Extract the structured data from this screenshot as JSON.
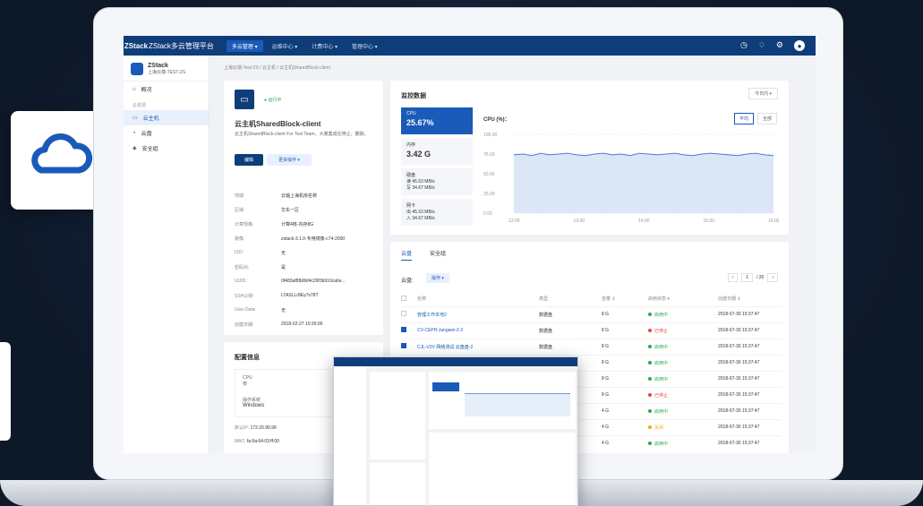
{
  "header": {
    "logo": "ZStack",
    "app_title": "ZStack多云管理平台",
    "nav": [
      "多云管理 ▾",
      "运维中心 ▾",
      "计费中心 ▾",
      "管理中心 ▾"
    ],
    "icons": [
      "history-icon",
      "bell-icon",
      "gear-icon",
      "user-icon"
    ]
  },
  "sidebar": {
    "zone_name": "ZStack",
    "zone_sub": "上海云端-TEST-ZS",
    "overview": "概况",
    "section": "云资源",
    "items": [
      "云主机",
      "云盘",
      "安全组"
    ]
  },
  "breadcrumb": "上海云端-Test-ZS / 云主机 / 云主机SharedBlock-client",
  "vm": {
    "status": "运行中",
    "name": "云主机SharedBlock-client",
    "desc": "云主机SharedBlock-client For Test Team，大量集成在停止、删除。",
    "edit": "编辑",
    "more": "更多操作 ▾",
    "props": [
      {
        "k": "地域:",
        "v": "云轴上海机房名称"
      },
      {
        "k": "区域:",
        "v": "华东一区"
      },
      {
        "k": "计算规格:",
        "v": "计算4核-内存8G"
      },
      {
        "k": "镜像:",
        "v": "zstack-3.1.0-专用镜像-c74-2000"
      },
      {
        "k": "ISO:",
        "v": "无"
      },
      {
        "k": "密码对:",
        "v": "是"
      },
      {
        "k": "UUID:",
        "v": "0f483af8fb0bf4c29f3b910ca6e..."
      },
      {
        "k": "SSH公钥:",
        "v": "LTASLLr8Ey7s78T"
      },
      {
        "k": "User Data:",
        "v": "无"
      },
      {
        "k": "创建日期:",
        "v": "2018-02-27 10:35:00"
      }
    ]
  },
  "config": {
    "title": "配置信息",
    "cpu_label": "CPU",
    "cpu_value": "核",
    "os_label": "操作系统",
    "os_value": "Windows",
    "ip_label": "默认IP:",
    "ip_value": "172.20.99.99",
    "mac_label": "MAC:",
    "mac_value": "fa:6a:64:03:ff:00"
  },
  "monitor": {
    "title": "监控数据",
    "range": "今日内 ▾",
    "cpu_label": "CPU",
    "cpu_value": "25.67%",
    "mem_label": "内存",
    "mem_value": "3.42 G",
    "disk_label": "硬盘",
    "disk_read": "读  45.53 MB/s",
    "disk_write": "写  34.67 MB/s",
    "net_label": "网卡",
    "net_out": "出  45.53 MB/s",
    "net_in": "入  34.67 MB/s",
    "chart_title": "CPU (%)：",
    "seg_avg": "平均",
    "seg_all": "全部"
  },
  "chart_data": {
    "type": "area",
    "title": "CPU (%)：",
    "x": [
      "12:00",
      "13:00",
      "14:00",
      "15:00",
      "16:00"
    ],
    "y_ticks": [
      "100.00",
      "75.00",
      "50.00",
      "25.00",
      "0.00"
    ],
    "ylim": [
      0,
      100
    ],
    "values": [
      74,
      75,
      73,
      76,
      74,
      75,
      76,
      74,
      73,
      75,
      76,
      74,
      75,
      73,
      76,
      75,
      74,
      75,
      76,
      74,
      73,
      75,
      76,
      75,
      74,
      73,
      75,
      76,
      74,
      73
    ]
  },
  "disks": {
    "tabs": [
      "云盘",
      "安全组"
    ],
    "label": "云盘:",
    "op": "操作 ▾",
    "page": "1",
    "pages": "/ 20",
    "columns": [
      "名称",
      "类型",
      "容量 ⇕",
      "启用状态 ▾",
      "创建日期 ⇕"
    ],
    "rows": [
      {
        "checked": false,
        "name": "管理工作本地2",
        "type": "数据盘",
        "size": "8 G",
        "state": "启用中",
        "color": "#2ea84f",
        "date": "2018-07-30 15:37:47"
      },
      {
        "checked": true,
        "name": "CV-CEPH-Jangwei-2-2",
        "type": "数据盘",
        "size": "8 G",
        "state": "已停止",
        "color": "#e04a3c",
        "date": "2018-07-30 15:37:47"
      },
      {
        "checked": true,
        "name": "CJL-V2V 网络测试 云盘盘-2",
        "type": "数据盘",
        "size": "8 G",
        "state": "启用中",
        "color": "#2ea84f",
        "date": "2018-07-30 15:37:47"
      },
      {
        "checked": false,
        "name": "",
        "type": "",
        "size": "8 G",
        "state": "启用中",
        "color": "#2ea84f",
        "date": "2018-07-30 15:37:47"
      },
      {
        "checked": false,
        "name": "",
        "type": "",
        "size": "8 G",
        "state": "启用中",
        "color": "#2ea84f",
        "date": "2018-07-30 15:37:47"
      },
      {
        "checked": false,
        "name": "",
        "type": "",
        "size": "8 G",
        "state": "已停止",
        "color": "#e04a3c",
        "date": "2018-07-30 15:37:47"
      },
      {
        "checked": false,
        "name": "",
        "type": "",
        "size": "4 G",
        "state": "启用中",
        "color": "#2ea84f",
        "date": "2018-07-30 15:37:47"
      },
      {
        "checked": false,
        "name": "",
        "type": "",
        "size": "4 G",
        "state": "关闭",
        "color": "#f5a623",
        "date": "2018-07-30 15:37:47"
      },
      {
        "checked": false,
        "name": "",
        "type": "",
        "size": "4 G",
        "state": "启用中",
        "color": "#2ea84f",
        "date": "2018-07-30 15:37:47"
      }
    ]
  }
}
